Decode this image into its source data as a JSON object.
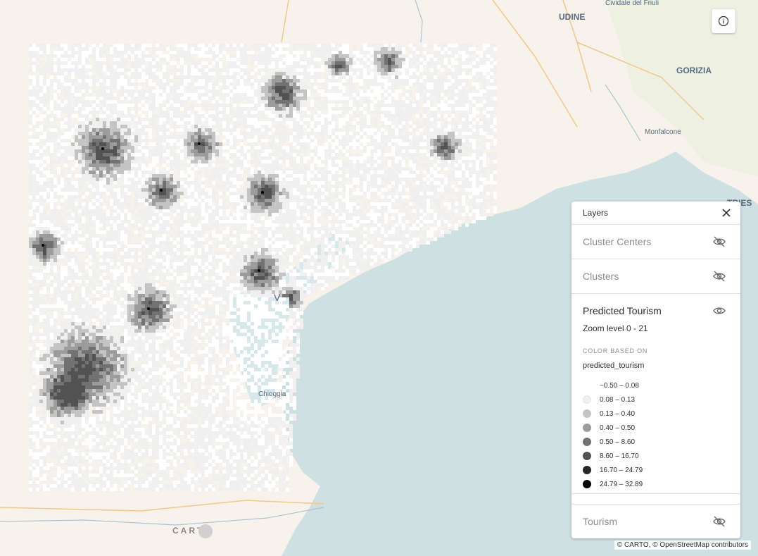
{
  "map": {
    "places": {
      "cividale": "Cividale del Friuli",
      "udine": "UDINE",
      "gorizia": "GORIZIA",
      "monfalcone": "Monfalcone",
      "trieste": "TRIES",
      "chioggia": "Chioggia",
      "venezia": "V"
    },
    "water_color": "#cfe0e3",
    "land_color": "#f7f3ec"
  },
  "info_button": {
    "icon": "info-icon"
  },
  "carto_logo": "CART",
  "attribution": "© CARTO, © OpenStreetMap contributors",
  "layers_panel": {
    "title": "Layers",
    "close_icon": "close-icon",
    "layers": [
      {
        "name": "Cluster Centers",
        "visible": false
      },
      {
        "name": "Clusters",
        "visible": false
      },
      {
        "name": "Predicted Tourism",
        "visible": true,
        "zoom": "Zoom level 0 - 21",
        "color_based_on_label": "COLOR BASED ON",
        "attribute": "predicted_tourism"
      },
      {
        "name": "Tourism",
        "visible": false
      }
    ],
    "legend": [
      {
        "label": "−0.50 – 0.08",
        "color": "#ffffff"
      },
      {
        "label": "0.08 – 0.13",
        "color": "#f0f0f0"
      },
      {
        "label": "0.13 – 0.40",
        "color": "#c4c4c4"
      },
      {
        "label": "0.40 – 0.50",
        "color": "#9c9c9c"
      },
      {
        "label": "0.50 – 8.60",
        "color": "#727272"
      },
      {
        "label": "8.60 – 16.70",
        "color": "#525252"
      },
      {
        "label": "16.70 – 24.79",
        "color": "#262626"
      },
      {
        "label": "24.79 – 32.89",
        "color": "#000000"
      }
    ]
  }
}
